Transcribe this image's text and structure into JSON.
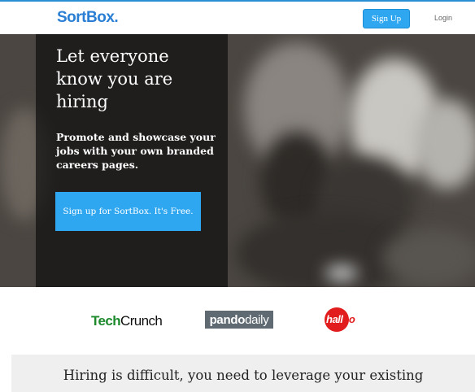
{
  "header": {
    "logo": "SortBox.",
    "signup_label": "Sign Up",
    "login_label": "Login"
  },
  "hero": {
    "title": "Let everyone know you are hiring",
    "subtitle": "Promote and showcase your jobs with your own branded careers pages.",
    "cta_label": "Sign up for SortBox. It's Free."
  },
  "press": {
    "techcrunch": "TechCrunch",
    "pando": "pandodaily",
    "halloo": "halloo"
  },
  "section": {
    "title": "Hiring is difficult, you need to leverage your existing"
  },
  "colors": {
    "accent": "#2fa7f0",
    "logo": "#2a7fd4"
  }
}
